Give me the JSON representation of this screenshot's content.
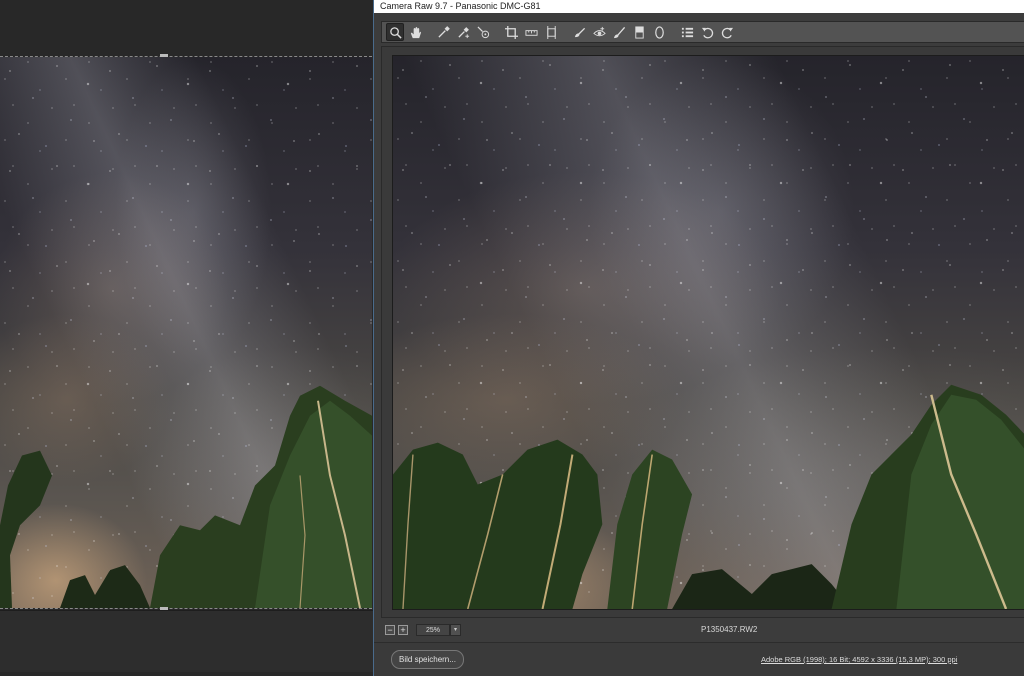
{
  "window": {
    "title": "Camera Raw 9.7 - Panasonic DMC-G81"
  },
  "toolbar": {
    "tools": [
      {
        "name": "zoom-tool",
        "icon": "magnifier-icon",
        "active": true
      },
      {
        "name": "hand-tool",
        "icon": "hand-icon"
      },
      {
        "name": "white-balance-tool",
        "icon": "eyedropper-icon"
      },
      {
        "name": "color-sampler-tool",
        "icon": "eyedropper-plus-icon"
      },
      {
        "name": "targeted-adjustment-tool",
        "icon": "target-icon"
      },
      {
        "name": "crop-tool",
        "icon": "crop-icon"
      },
      {
        "name": "straighten-tool",
        "icon": "ruler-icon"
      },
      {
        "name": "transform-tool",
        "icon": "transform-icon"
      },
      {
        "name": "spot-removal-tool",
        "icon": "brush-spot-icon"
      },
      {
        "name": "red-eye-tool",
        "icon": "eye-icon"
      },
      {
        "name": "adjustment-brush-tool",
        "icon": "brush-icon"
      },
      {
        "name": "graduated-filter-tool",
        "icon": "gradient-icon"
      },
      {
        "name": "radial-filter-tool",
        "icon": "ellipse-icon"
      },
      {
        "name": "preferences",
        "icon": "list-icon"
      },
      {
        "name": "rotate-left",
        "icon": "rotate-ccw-icon"
      },
      {
        "name": "rotate-right",
        "icon": "rotate-cw-icon"
      }
    ]
  },
  "status": {
    "zoom_out_label": "−",
    "zoom_in_label": "+",
    "zoom": "25%",
    "zoom_dropdown": "▾",
    "filename": "P1350437.RW2"
  },
  "footer": {
    "save_label": "Bild speichern...",
    "workflow_options": "Adobe RGB (1998); 16 Bit; 4592 x 3336 (15,3 MP); 300 ppi"
  },
  "colors": {
    "dialog_bg": "#3c3c3c",
    "toolbar_bg": "#535353",
    "window_border": "#4a6b8c"
  }
}
